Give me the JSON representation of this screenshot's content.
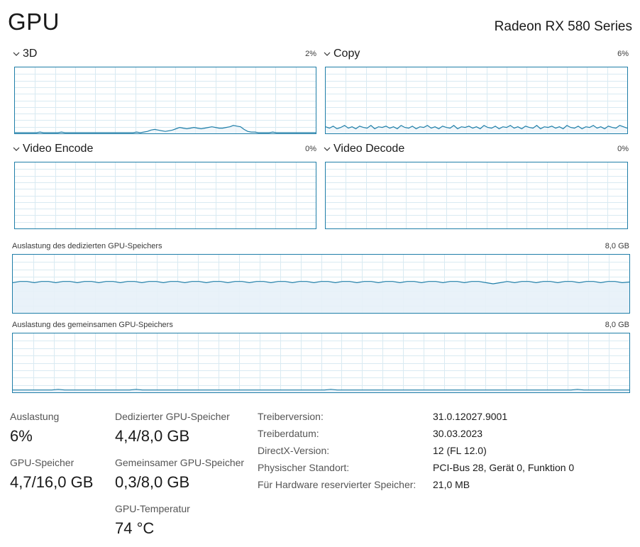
{
  "header": {
    "title": "GPU",
    "device": "Radeon RX 580 Series"
  },
  "engines": [
    {
      "label": "3D",
      "percent": "2%",
      "series": [
        1,
        1,
        1,
        1,
        1,
        1,
        1,
        2,
        1,
        1,
        1,
        1,
        1,
        2,
        1,
        1,
        1,
        1,
        1,
        1,
        1,
        1,
        1,
        1,
        1,
        1,
        1,
        1,
        1,
        1,
        1,
        1,
        1,
        1,
        2,
        1,
        2,
        3,
        5,
        6,
        5,
        4,
        3,
        4,
        5,
        7,
        9,
        8,
        7,
        8,
        9,
        8,
        7,
        8,
        9,
        10,
        9,
        8,
        8,
        9,
        10,
        12,
        11,
        10,
        6,
        3,
        2,
        2,
        1,
        1,
        1,
        1,
        2,
        1,
        1,
        1,
        1,
        1,
        1,
        1,
        1,
        1,
        1,
        1,
        1
      ]
    },
    {
      "label": "Copy",
      "percent": "6%",
      "series": [
        10,
        8,
        11,
        7,
        9,
        12,
        8,
        10,
        7,
        11,
        9,
        8,
        12,
        7,
        10,
        9,
        11,
        8,
        10,
        7,
        12,
        9,
        8,
        11,
        7,
        10,
        9,
        12,
        8,
        10,
        7,
        11,
        9,
        8,
        12,
        7,
        10,
        9,
        11,
        8,
        10,
        7,
        12,
        9,
        8,
        11,
        7,
        10,
        9,
        12,
        8,
        10,
        7,
        11,
        9,
        8,
        12,
        7,
        10,
        9,
        11,
        8,
        10,
        7,
        12,
        9,
        8,
        11,
        7,
        10,
        9,
        12,
        8,
        10,
        7,
        11,
        9,
        8,
        12,
        10,
        8
      ]
    },
    {
      "label": "Video Encode",
      "percent": "0%",
      "series": []
    },
    {
      "label": "Video Decode",
      "percent": "0%",
      "series": []
    }
  ],
  "memory_graphs": [
    {
      "label": "Auslastung des dedizierten GPU-Speichers",
      "max": "8,0 GB",
      "series": [
        52,
        54,
        54,
        52,
        54,
        54,
        52,
        54,
        54,
        52,
        54,
        54,
        52,
        54,
        54,
        52,
        54,
        54,
        52,
        54,
        54,
        52,
        54,
        54,
        52,
        54,
        54,
        52,
        54,
        54,
        52,
        54,
        54,
        52,
        54,
        54,
        52,
        54,
        54,
        52,
        54,
        54,
        52,
        54,
        54,
        52,
        54,
        54,
        52,
        54,
        54,
        52,
        54,
        54,
        52,
        54,
        54,
        52,
        54,
        54,
        52,
        54,
        54,
        52,
        54,
        54,
        52,
        50,
        52,
        54,
        52,
        54,
        54,
        52,
        54,
        54,
        52,
        54,
        54,
        52,
        54,
        54,
        52,
        54,
        54,
        52,
        53
      ]
    },
    {
      "label": "Auslastung des gemeinsamen GPU-Speichers",
      "max": "8,0 GB",
      "series": [
        4,
        4,
        4,
        4,
        4,
        4,
        4,
        5,
        4,
        4,
        4,
        4,
        4,
        4,
        4,
        4,
        4,
        4,
        4,
        5,
        4,
        4,
        4,
        4,
        4,
        4,
        4,
        4,
        4,
        4,
        4,
        4,
        4,
        4,
        4,
        4,
        4,
        4,
        4,
        4,
        4,
        4,
        4,
        4,
        4,
        4,
        4,
        4,
        4,
        5,
        4,
        4,
        4,
        4,
        4,
        4,
        4,
        4,
        4,
        4,
        4,
        4,
        4,
        4,
        4,
        4,
        4,
        4,
        4,
        4,
        4,
        4,
        4,
        4,
        4,
        4,
        4,
        4,
        4,
        4,
        4,
        4,
        4,
        4,
        4,
        4,
        4,
        5,
        4,
        4,
        4,
        4,
        4,
        4,
        4,
        4
      ]
    }
  ],
  "stats": {
    "utilization_label": "Auslastung",
    "utilization_value": "6%",
    "gpu_memory_label": "GPU-Speicher",
    "gpu_memory_value": "4,7/16,0 GB",
    "dedicated_label": "Dedizierter GPU-Speicher",
    "dedicated_value": "4,4/8,0 GB",
    "shared_label": "Gemeinsamer GPU-Speicher",
    "shared_value": "0,3/8,0 GB",
    "temp_label": "GPU-Temperatur",
    "temp_value": "74 °C"
  },
  "info": [
    {
      "label": "Treiberversion:",
      "value": "31.0.12027.9001"
    },
    {
      "label": "Treiberdatum:",
      "value": "30.03.2023"
    },
    {
      "label": "DirectX-Version:",
      "value": "12 (FL 12.0)"
    },
    {
      "label": "Physischer Standort:",
      "value": "PCI-Bus 28, Gerät 0, Funktion 0"
    },
    {
      "label": "Für Hardware reservierter Speicher:",
      "value": "21,0 MB"
    }
  ],
  "colors": {
    "graph_border": "#1f7ea8",
    "graph_grid": "#d9eaf2",
    "graph_line": "#1f7ea8",
    "graph_fill": "#e7f1f8"
  }
}
